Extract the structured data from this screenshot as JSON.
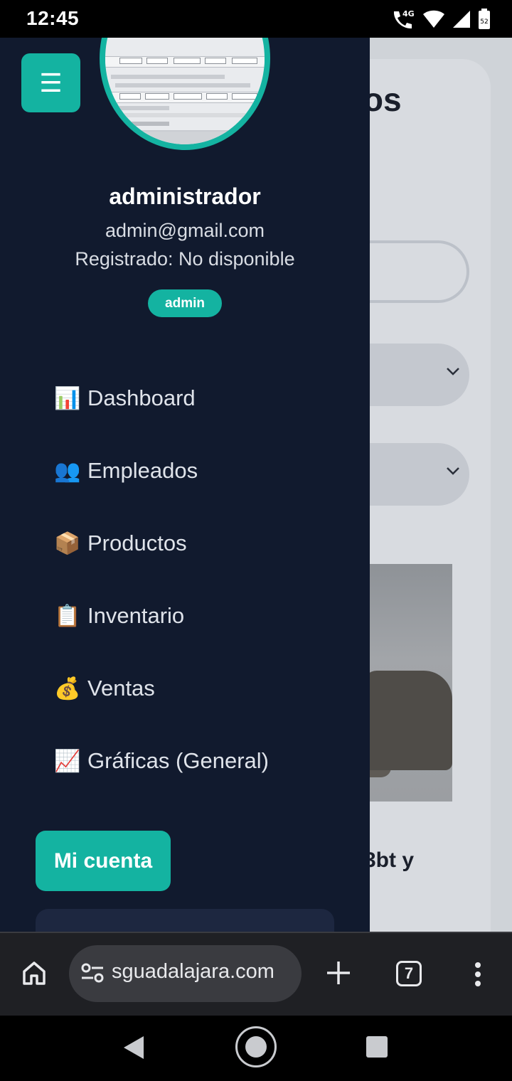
{
  "status_bar": {
    "time": "12:45",
    "network": "4G",
    "battery": "52"
  },
  "background_page": {
    "title_fragment": "ctos",
    "product_caption_fragment": "3bt y"
  },
  "drawer": {
    "menu_button_glyph": "☰",
    "user": {
      "name": "administrador",
      "email": "admin@gmail.com",
      "registered": "Registrado: No disponible",
      "role_badge": "admin"
    },
    "menu_items": [
      {
        "emoji": "📊",
        "label": "Dashboard",
        "icon": "bar-chart-icon"
      },
      {
        "emoji": "👥",
        "label": "Empleados",
        "icon": "users-icon"
      },
      {
        "emoji": "📦",
        "label": "Productos",
        "icon": "package-icon"
      },
      {
        "emoji": "📋",
        "label": "Inventario",
        "icon": "clipboard-icon"
      },
      {
        "emoji": "💰",
        "label": "Ventas",
        "icon": "money-bag-icon"
      },
      {
        "emoji": "📈",
        "label": "Gráficas (General)",
        "icon": "trend-chart-icon"
      }
    ],
    "account_button": "Mi cuenta"
  },
  "browser": {
    "url": "sguadalajara.com",
    "tab_count": "7"
  },
  "colors": {
    "accent": "#14b3a1",
    "drawer_bg": "#111a2e",
    "overlay": "#cfd3d8"
  }
}
